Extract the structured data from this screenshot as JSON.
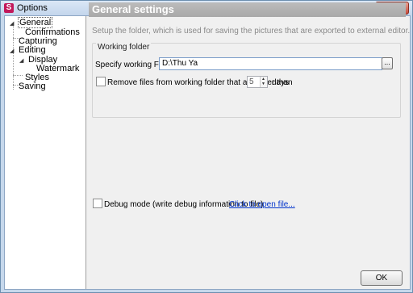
{
  "window": {
    "title": "Options",
    "app_icon": "S",
    "close_label": "x"
  },
  "tree": {
    "items": [
      {
        "label": "General",
        "expanded": true,
        "selected": true
      },
      {
        "label": "Confirmations"
      },
      {
        "label": "Capturing"
      },
      {
        "label": "Editing",
        "expanded": true
      },
      {
        "label": "Display",
        "expanded": true
      },
      {
        "label": "Watermark"
      },
      {
        "label": "Styles"
      },
      {
        "label": "Saving"
      }
    ]
  },
  "main": {
    "header": "General settings",
    "subtitle": "Setup the folder, which is used for saving the pictures that are exported to external editor.",
    "working_folder": {
      "group_label": "Working folder",
      "field_label": "Specify working Folder:",
      "folder_value": "D:\\Thu Ya",
      "browse_label": "...",
      "remove_label": "Remove files from working folder that are older than",
      "days_value": "5",
      "days_label": "days"
    },
    "debug_label": "Debug mode (write debug information to file)",
    "open_file_link": "Click to open file...",
    "ok_label": "OK"
  }
}
